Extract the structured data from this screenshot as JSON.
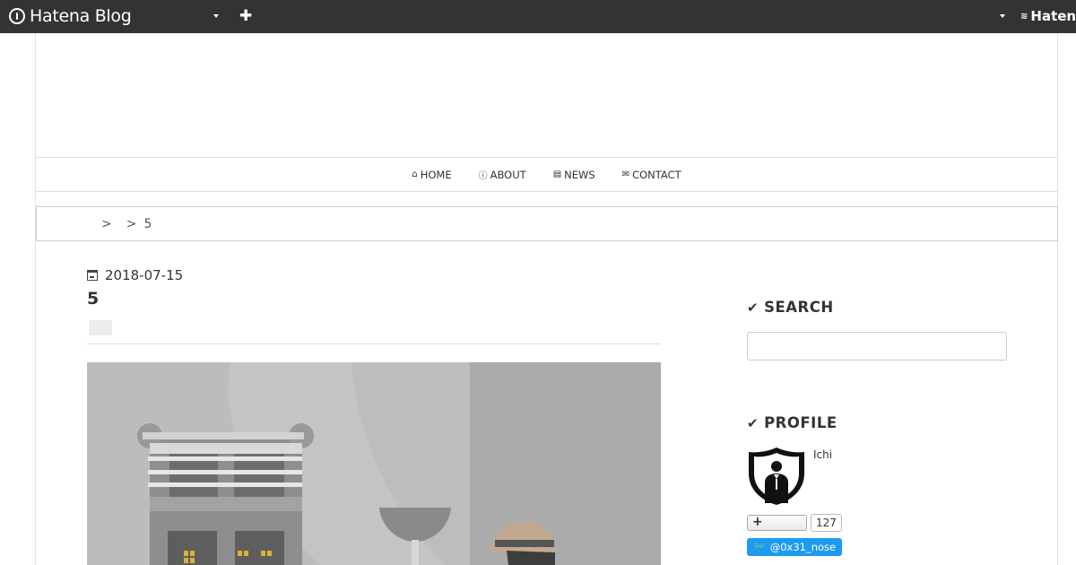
{
  "topbar": {
    "brand": "Hatena Blog",
    "right_brand": "Hatena"
  },
  "nav": {
    "items": [
      {
        "label": "HOME",
        "icon": "home-icon"
      },
      {
        "label": "ABOUT",
        "icon": "info-icon"
      },
      {
        "label": "NEWS",
        "icon": "newspaper-icon"
      },
      {
        "label": "CONTACT",
        "icon": "envelope-icon"
      }
    ]
  },
  "breadcrumb": {
    "crumb1": " ",
    "crumb2": "    ",
    "separator": ">",
    "current": "5"
  },
  "article": {
    "date": "2018-07-15",
    "title": "5"
  },
  "sidebar": {
    "search_heading": "SEARCH",
    "profile_heading": "PROFILE",
    "profile_name": "Ichi",
    "subscriber_count": "127",
    "twitter_handle": "@0x31_nose"
  },
  "colors": {
    "topbar": "#333333",
    "link": "#2e7bd3",
    "twitter": "#1d9bf0"
  }
}
